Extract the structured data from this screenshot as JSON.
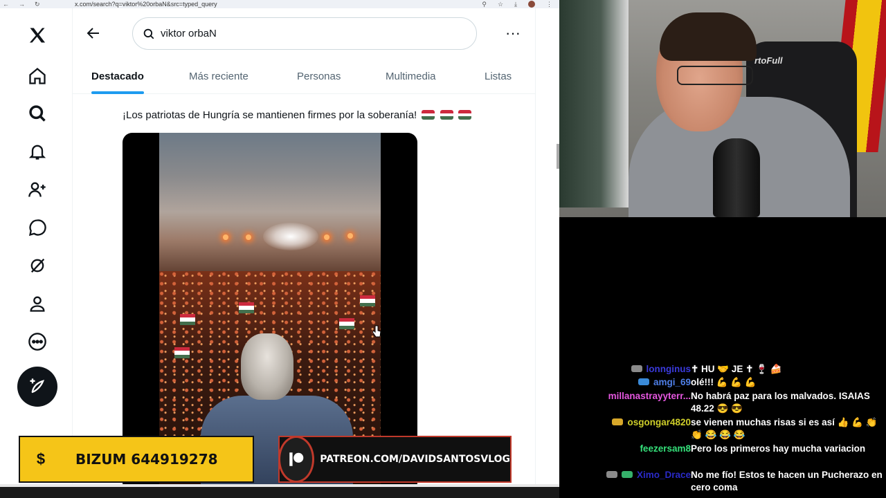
{
  "browser": {
    "url": "x.com/search?q=viktor%20orbaN&src=typed_query"
  },
  "search": {
    "query": "viktor orbaN"
  },
  "tabs": [
    {
      "label": "Destacado"
    },
    {
      "label": "Más reciente"
    },
    {
      "label": "Personas"
    },
    {
      "label": "Multimedia"
    },
    {
      "label": "Listas"
    }
  ],
  "tweet": {
    "text": "¡Los patriotas de Hungría se mantienen firmes por la soberanía!"
  },
  "colors": {
    "accent": "#1d9bf0",
    "hungary_red": "#cd2a3e",
    "hungary_white": "#ffffff",
    "hungary_green": "#436f4d",
    "bizum_yellow": "#f5c518",
    "patreon_red": "#c0392b"
  },
  "banners": {
    "bizum": "BIZUM 644919278",
    "bizum_symbol": "$",
    "patreon": "PATREON.COM/DAVIDSANTOSVLOG"
  },
  "webcam": {
    "chair_brand": "rtoFull"
  },
  "chat": [
    {
      "name": "lonnginus",
      "name_color": "#3a3adb",
      "text": "✝ HU 🤝 JE ✝ 🍷 🍰"
    },
    {
      "name": "amgi_69",
      "name_color": "#4f7fe8",
      "text": "olé!!! 💪 💪 💪"
    },
    {
      "name": "millanastrayyterr...",
      "name_color": "#e657e0",
      "text": "No habrá paz para los malvados. ISAIAS 48.22 😎 😎"
    },
    {
      "name": "osgongar4820",
      "name_color": "#cfcf2a",
      "text": "se vienen muchas risas si es así 👍 💪 👏 👏 😂 😂 😂"
    },
    {
      "name": "feezersam8",
      "name_color": "#35e07a",
      "text": "Pero los primeros hay mucha variacion"
    },
    {
      "name": "Ximo_Drace",
      "name_color": "#2a2ac8",
      "text": "No me fío! Estos te hacen un Pucherazo en cero coma"
    }
  ]
}
